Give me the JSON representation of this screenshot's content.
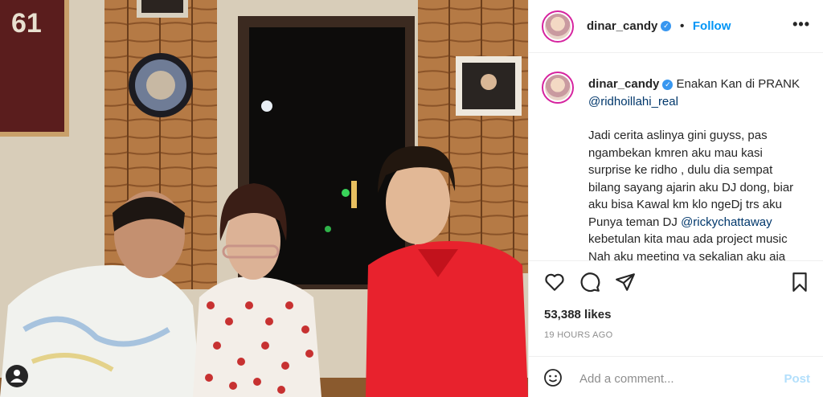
{
  "post": {
    "username": "dinar_candy",
    "follow_label": "Follow",
    "more_label": "•••",
    "caption_title": "Enakan Kan di PRANK",
    "caption_mention": "@ridhoillahi_real",
    "caption_p1": "Jadi cerita aslinya gini guyss, pas ngambekan kmren aku mau kasi surprise ke ridho , dulu dia sempat bilang sayang ajarin aku DJ dong, biar aku bisa Kawal km klo ngeDj trs aku Punya teman DJ",
    "caption_mention2": "@rickychattaway",
    "caption_p2": "kebetulan kita mau ada project music Nah aku meeting ya sekalian aku aja upload IG soalnga Ridho",
    "likes": "53,388 likes",
    "timestamp": "19 HOURS AGO",
    "comment_placeholder": "Add a comment...",
    "post_label": "Post"
  },
  "colors": {
    "accent": "#0095f6",
    "verified": "#3897f0",
    "post_disabled": "#b2dffc"
  },
  "icons": [
    "heart-icon",
    "comment-icon",
    "share-icon",
    "bookmark-icon",
    "emoji-icon",
    "verified-icon",
    "user-tag-icon"
  ]
}
